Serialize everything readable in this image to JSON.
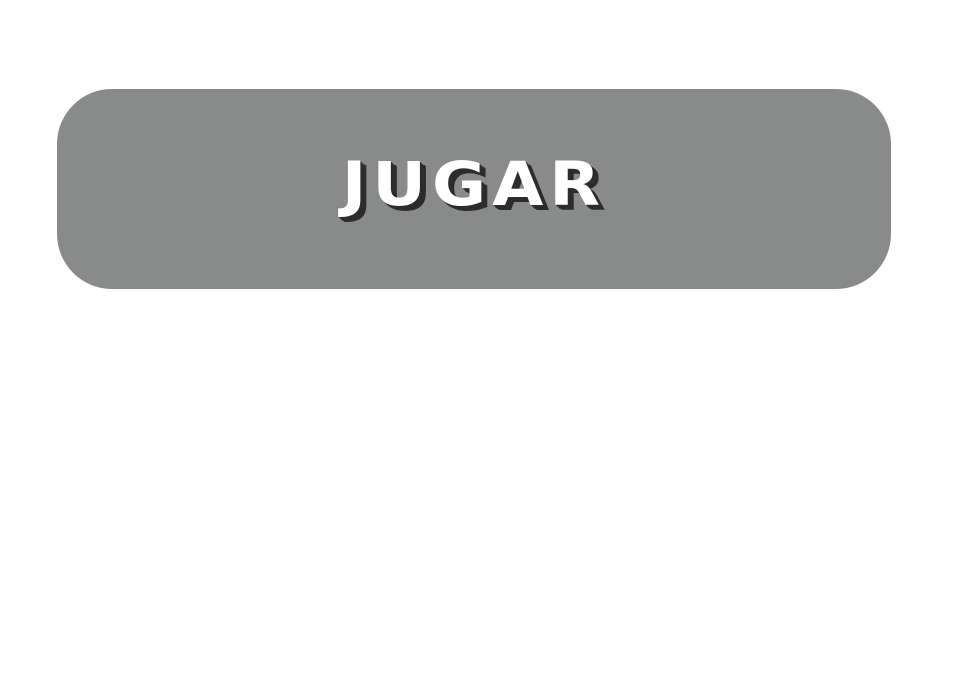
{
  "menu": {
    "play_button_label": "JUGAR"
  },
  "colors": {
    "background": "#ffffff",
    "button_fill": "#898b8b",
    "label_fill": "#ffffff",
    "label_shadow": "#2c2c2c"
  }
}
